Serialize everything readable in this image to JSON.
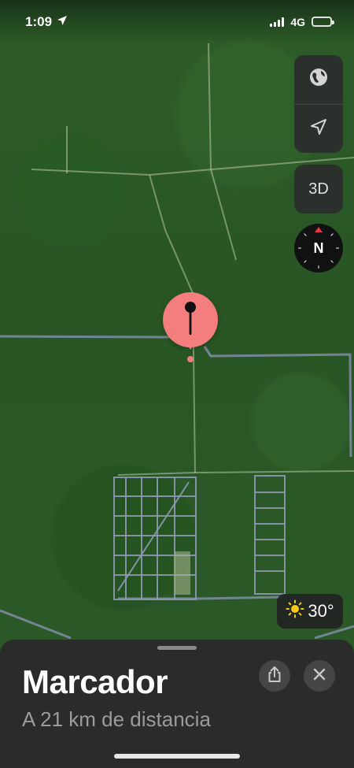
{
  "status_bar": {
    "time": "1:09",
    "network": "4G"
  },
  "map_controls": {
    "btn_3d": "3D",
    "compass_label": "N"
  },
  "weather": {
    "temp": "30°"
  },
  "place": {
    "title": "Marcador",
    "subtitle": "A 21 km de distancia"
  },
  "colors": {
    "pin": "#f47d7e",
    "sheet": "#2b2b2b",
    "battery": "#f6d22a",
    "compass_red": "#e23b3b"
  },
  "icons": [
    "location-arrow-icon",
    "signal-bars-icon",
    "battery-icon",
    "globe-icon",
    "navigation-arrow-icon",
    "compass-icon",
    "pin-icon",
    "sun-icon",
    "share-icon",
    "close-icon"
  ]
}
